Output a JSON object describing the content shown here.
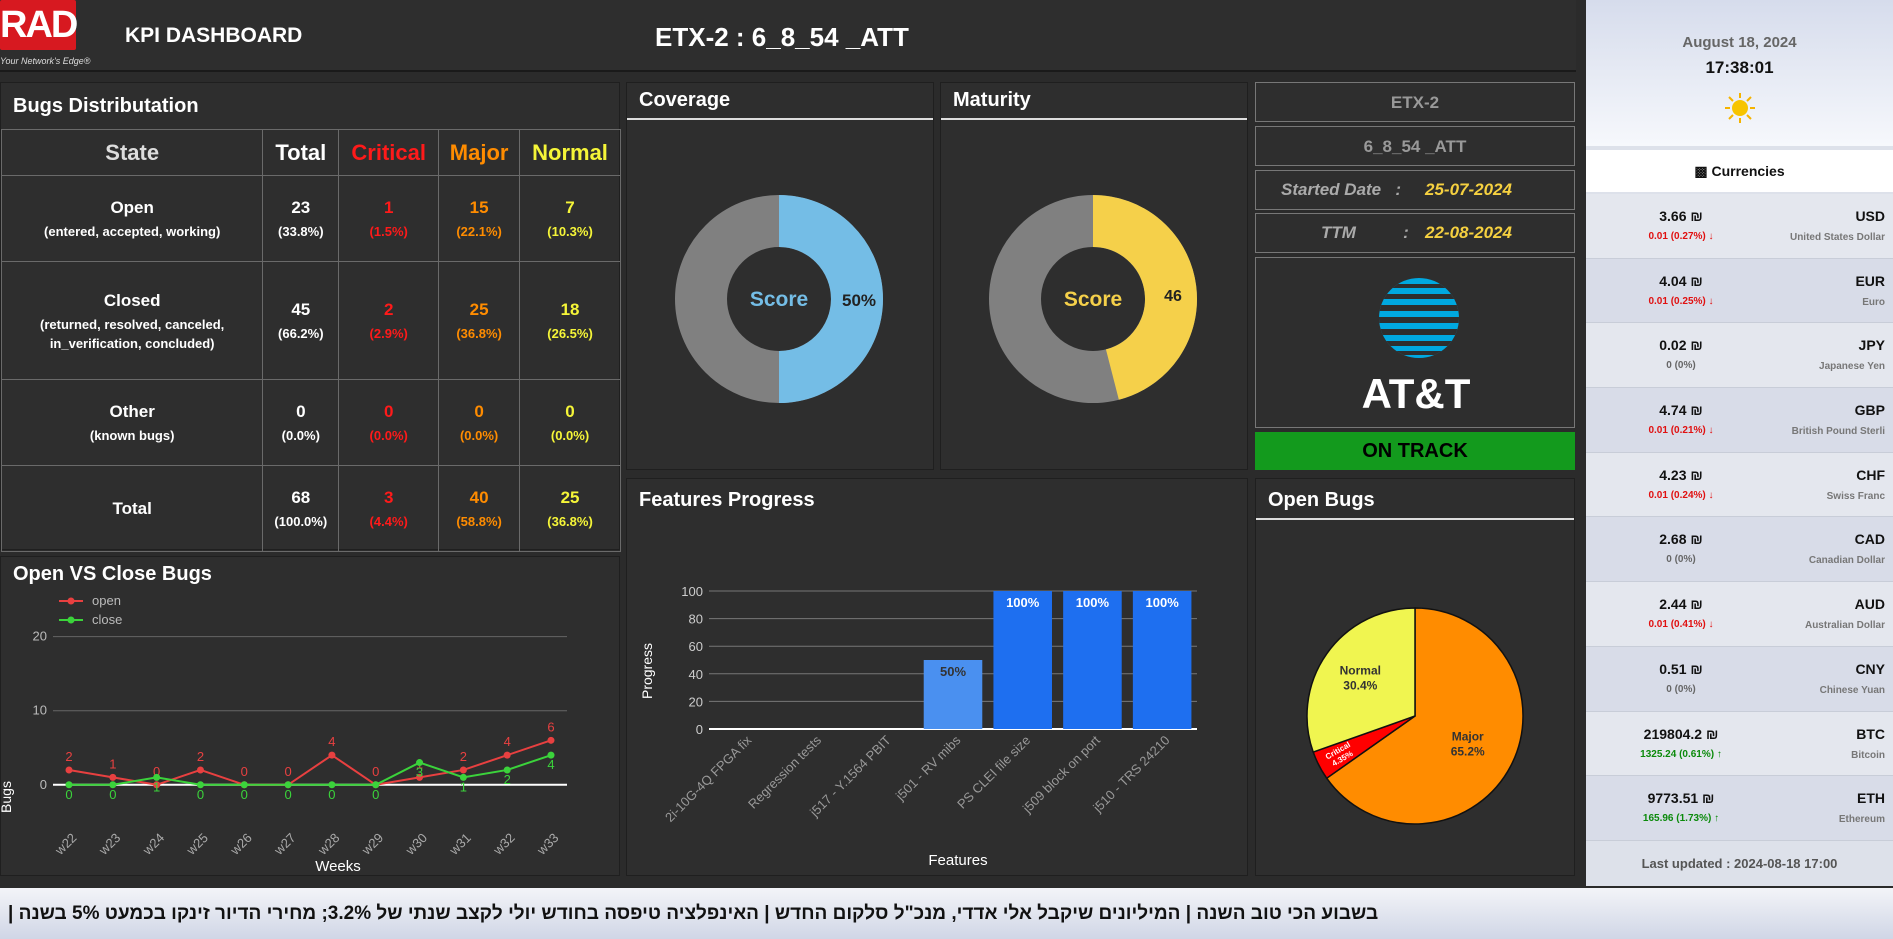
{
  "header": {
    "logo_text": "RAD",
    "logo_tagline": "Your Network's Edge®",
    "dashboard_title": "KPI DASHBOARD",
    "main_title": "ETX-2 : 6_8_54 _ATT"
  },
  "bugs_distribution": {
    "title": "Bugs Distributation",
    "headers": [
      "State",
      "Total",
      "Critical",
      "Major",
      "Normal"
    ],
    "rows": [
      {
        "state": "Open",
        "desc": "(entered, accepted, working)",
        "total": "23",
        "total_pct": "(33.8%)",
        "critical": "1",
        "critical_pct": "(1.5%)",
        "major": "15",
        "major_pct": "(22.1%)",
        "normal": "7",
        "normal_pct": "(10.3%)"
      },
      {
        "state": "Closed",
        "desc": "(returned, resolved, canceled,",
        "desc2": "in_verification, concluded)",
        "total": "45",
        "total_pct": "(66.2%)",
        "critical": "2",
        "critical_pct": "(2.9%)",
        "major": "25",
        "major_pct": "(36.8%)",
        "normal": "18",
        "normal_pct": "(26.5%)"
      },
      {
        "state": "Other",
        "desc": "(known bugs)",
        "total": "0",
        "total_pct": "(0.0%)",
        "critical": "0",
        "critical_pct": "(0.0%)",
        "major": "0",
        "major_pct": "(0.0%)",
        "normal": "0",
        "normal_pct": "(0.0%)"
      },
      {
        "state": "Total",
        "desc": "",
        "total": "68",
        "total_pct": "(100.0%)",
        "critical": "3",
        "critical_pct": "(4.4%)",
        "major": "40",
        "major_pct": "(58.8%)",
        "normal": "25",
        "normal_pct": "(36.8%)"
      }
    ]
  },
  "coverage": {
    "title": "Coverage",
    "center_label": "Score",
    "value_label": "50%",
    "fill_color": "#74bde6"
  },
  "maturity": {
    "title": "Maturity",
    "center_label": "Score",
    "value_label": "46",
    "fill_color": "#f5d04a"
  },
  "project_info": {
    "product": "ETX-2",
    "version": "6_8_54 _ATT",
    "started_label": "Started Date",
    "started_sep": ":",
    "started_value": "25-07-2024",
    "ttm_label": "TTM",
    "ttm_sep": ":",
    "ttm_value": "22-08-2024",
    "customer_logo_text": "AT&T",
    "status": "ON TRACK"
  },
  "colors": {
    "critical": "#ff1a1a",
    "major": "#ff8c00",
    "normal": "#f5f538",
    "on_track": "#139a1d",
    "open_line": "#e84040",
    "close_line": "#3bd33b",
    "bar": "#1e6ff0",
    "bar_light": "#4a90f0"
  },
  "chart_data": [
    {
      "type": "line",
      "title": "Open VS Close Bugs",
      "xlabel": "Weeks",
      "ylabel": "Bugs",
      "x": [
        "w22",
        "w23",
        "w24",
        "w25",
        "w26",
        "w27",
        "w28",
        "w29",
        "w30",
        "w31",
        "w32",
        "w33"
      ],
      "yticks": [
        0,
        10,
        20
      ],
      "ylim": [
        -3,
        24
      ],
      "legend_position": "top-left",
      "series": [
        {
          "name": "open",
          "values": [
            2,
            1,
            0,
            2,
            0,
            0,
            4,
            0,
            1,
            2,
            4,
            6
          ]
        },
        {
          "name": "close",
          "values": [
            0,
            0,
            1,
            0,
            0,
            0,
            0,
            0,
            3,
            1,
            2,
            4
          ]
        }
      ]
    },
    {
      "type": "bar",
      "title": "Features Progress",
      "xlabel": "Features",
      "ylabel": "Progress",
      "categories": [
        "2i-10G-4Q FPGA fix",
        "Regression tests",
        "j517 - Y.1564 PBIT",
        "j501 - RV mibs",
        "PS CLEI file size",
        "j509 block on port",
        "j510 - TRS 24210"
      ],
      "values": [
        0,
        0,
        0,
        50,
        100,
        100,
        100
      ],
      "value_labels": [
        "",
        "",
        "",
        "50%",
        "100%",
        "100%",
        "100%"
      ],
      "yticks": [
        0,
        20,
        40,
        60,
        80,
        100
      ],
      "ylim": [
        0,
        100
      ]
    },
    {
      "type": "pie",
      "title": "Open Bugs",
      "slices": [
        {
          "label": "Major",
          "pct_label": "65.2%",
          "value": 65.2,
          "color": "#ff8c00"
        },
        {
          "label": "Critical",
          "pct_label": "4.35%",
          "value": 4.35,
          "color": "#ff0000"
        },
        {
          "label": "Normal",
          "pct_label": "30.4%",
          "value": 30.4,
          "color": "#f0f550"
        }
      ]
    }
  ],
  "sidebar": {
    "date": "August 18, 2024",
    "time": "17:38:01",
    "weather_icon": "sun-icon",
    "currencies_title": "Currencies",
    "currencies_icon": "money-icon",
    "currencies": [
      {
        "value": "3.66 ₪",
        "change": "0.01 (0.27%) ↓",
        "dir": "down",
        "code": "USD",
        "name": "United States Dollar"
      },
      {
        "value": "4.04 ₪",
        "change": "0.01 (0.25%) ↓",
        "dir": "down",
        "code": "EUR",
        "name": "Euro"
      },
      {
        "value": "0.02 ₪",
        "change": "0 (0%)",
        "dir": "flat",
        "code": "JPY",
        "name": "Japanese Yen"
      },
      {
        "value": "4.74 ₪",
        "change": "0.01 (0.21%) ↓",
        "dir": "down",
        "code": "GBP",
        "name": "British Pound Sterli"
      },
      {
        "value": "4.23 ₪",
        "change": "0.01 (0.24%) ↓",
        "dir": "down",
        "code": "CHF",
        "name": "Swiss Franc"
      },
      {
        "value": "2.68 ₪",
        "change": "0 (0%)",
        "dir": "flat",
        "code": "CAD",
        "name": "Canadian Dollar"
      },
      {
        "value": "2.44 ₪",
        "change": "0.01 (0.41%) ↓",
        "dir": "down",
        "code": "AUD",
        "name": "Australian Dollar"
      },
      {
        "value": "0.51 ₪",
        "change": "0 (0%)",
        "dir": "flat",
        "code": "CNY",
        "name": "Chinese Yuan"
      },
      {
        "value": "219804.2 ₪",
        "change": "1325.24 (0.61%) ↑",
        "dir": "up",
        "code": "BTC",
        "name": "Bitcoin"
      },
      {
        "value": "9773.51 ₪",
        "change": "165.96 (1.73%) ↑",
        "dir": "up",
        "code": "ETH",
        "name": "Ethereum"
      }
    ],
    "last_updated": "Last updated : 2024-08-18 17:00"
  },
  "ticker": {
    "text": "| בשבוע הכי טוב השנה | המיליונים שיקבל אלי אדדי, מנכ\"ל סלקום החדש | האינפלציה טיפסה בחודש יולי לקצב שנתי של 3.2%; מחירי הדיור זינקו בכמעט 5% בשנה"
  }
}
